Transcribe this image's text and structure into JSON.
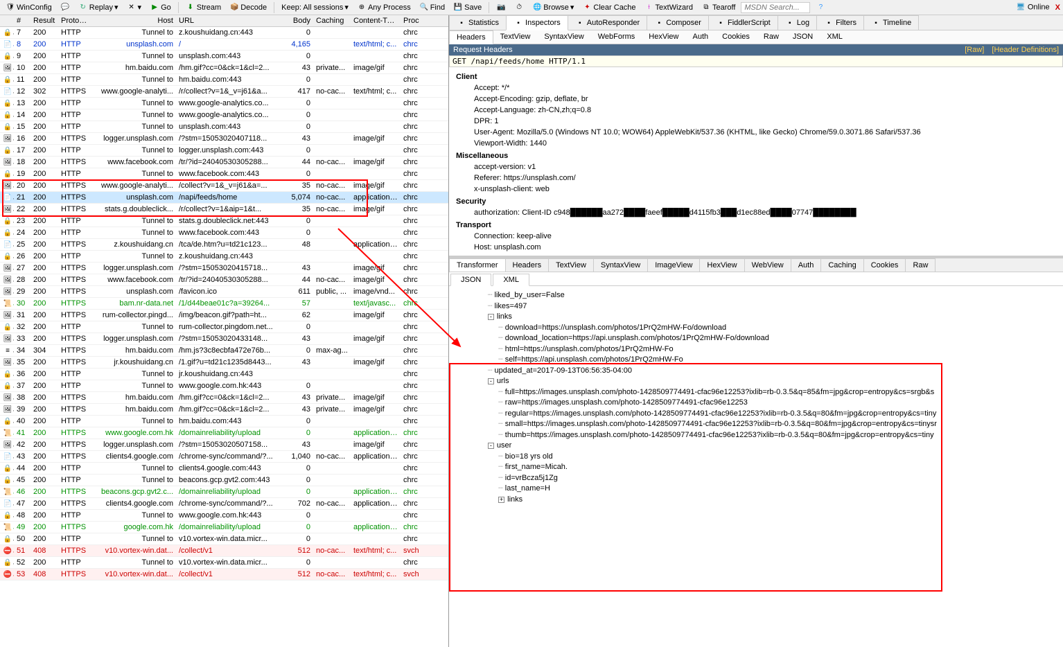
{
  "toolbar": {
    "winconfig": "WinConfig",
    "replay": "Replay",
    "go": "Go",
    "stream": "Stream",
    "decode": "Decode",
    "keep": "Keep: All sessions",
    "anyprocess": "Any Process",
    "find": "Find",
    "save": "Save",
    "browse": "Browse",
    "clearcache": "Clear Cache",
    "textwizard": "TextWizard",
    "tearoff": "Tearoff",
    "search_ph": "MSDN Search...",
    "online": "Online",
    "close": "X"
  },
  "columns": {
    "num": "#",
    "result": "Result",
    "protocol": "Protocol",
    "host": "Host",
    "url": "URL",
    "body": "Body",
    "caching": "Caching",
    "ctype": "Content-Type",
    "proc": "Proc"
  },
  "rows": [
    {
      "n": "7",
      "r": "200",
      "p": "HTTP",
      "h": "Tunnel to",
      "u": "z.koushuidang.cn:443",
      "b": "0",
      "c": "",
      "t": "",
      "pr": "chrc"
    },
    {
      "n": "8",
      "r": "200",
      "p": "HTTP",
      "h": "unsplash.com",
      "u": "/",
      "b": "4,165",
      "c": "",
      "t": "text/html; c...",
      "pr": "chrc",
      "cls": "blue"
    },
    {
      "n": "9",
      "r": "200",
      "p": "HTTP",
      "h": "Tunnel to",
      "u": "unsplash.com:443",
      "b": "0",
      "c": "",
      "t": "",
      "pr": "chrc"
    },
    {
      "n": "10",
      "r": "200",
      "p": "HTTP",
      "h": "hm.baidu.com",
      "u": "/hm.gif?cc=0&ck=1&cl=2...",
      "b": "43",
      "c": "private...",
      "t": "image/gif",
      "pr": "chrc"
    },
    {
      "n": "11",
      "r": "200",
      "p": "HTTP",
      "h": "Tunnel to",
      "u": "hm.baidu.com:443",
      "b": "0",
      "c": "",
      "t": "",
      "pr": "chrc"
    },
    {
      "n": "12",
      "r": "302",
      "p": "HTTPS",
      "h": "www.google-analyti...",
      "u": "/r/collect?v=1&_v=j61&a...",
      "b": "417",
      "c": "no-cac...",
      "t": "text/html; c...",
      "pr": "chrc"
    },
    {
      "n": "13",
      "r": "200",
      "p": "HTTP",
      "h": "Tunnel to",
      "u": "www.google-analytics.co...",
      "b": "0",
      "c": "",
      "t": "",
      "pr": "chrc"
    },
    {
      "n": "14",
      "r": "200",
      "p": "HTTP",
      "h": "Tunnel to",
      "u": "www.google-analytics.co...",
      "b": "0",
      "c": "",
      "t": "",
      "pr": "chrc"
    },
    {
      "n": "15",
      "r": "200",
      "p": "HTTP",
      "h": "Tunnel to",
      "u": "unsplash.com:443",
      "b": "0",
      "c": "",
      "t": "",
      "pr": "chrc"
    },
    {
      "n": "16",
      "r": "200",
      "p": "HTTPS",
      "h": "logger.unsplash.com",
      "u": "/?stm=15053020407118...",
      "b": "43",
      "c": "",
      "t": "image/gif",
      "pr": "chrc"
    },
    {
      "n": "17",
      "r": "200",
      "p": "HTTP",
      "h": "Tunnel to",
      "u": "logger.unsplash.com:443",
      "b": "0",
      "c": "",
      "t": "",
      "pr": "chrc"
    },
    {
      "n": "18",
      "r": "200",
      "p": "HTTPS",
      "h": "www.facebook.com",
      "u": "/tr/?id=24040530305288...",
      "b": "44",
      "c": "no-cac...",
      "t": "image/gif",
      "pr": "chrc"
    },
    {
      "n": "19",
      "r": "200",
      "p": "HTTP",
      "h": "Tunnel to",
      "u": "www.facebook.com:443",
      "b": "0",
      "c": "",
      "t": "",
      "pr": "chrc"
    },
    {
      "n": "20",
      "r": "200",
      "p": "HTTPS",
      "h": "www.google-analyti...",
      "u": "/collect?v=1&_v=j61&a=...",
      "b": "35",
      "c": "no-cac...",
      "t": "image/gif",
      "pr": "chrc"
    },
    {
      "n": "21",
      "r": "200",
      "p": "HTTPS",
      "h": "unsplash.com",
      "u": "/napi/feeds/home",
      "b": "5,074",
      "c": "no-cac...",
      "t": "application/...",
      "pr": "chrc",
      "cls": "sel"
    },
    {
      "n": "22",
      "r": "200",
      "p": "HTTPS",
      "h": "stats.g.doubleclick...",
      "u": "/r/collect?v=1&aip=1&t...",
      "b": "35",
      "c": "no-cac...",
      "t": "image/gif",
      "pr": "chrc"
    },
    {
      "n": "23",
      "r": "200",
      "p": "HTTP",
      "h": "Tunnel to",
      "u": "stats.g.doubleclick.net:443",
      "b": "0",
      "c": "",
      "t": "",
      "pr": "chrc"
    },
    {
      "n": "24",
      "r": "200",
      "p": "HTTP",
      "h": "Tunnel to",
      "u": "www.facebook.com:443",
      "b": "0",
      "c": "",
      "t": "",
      "pr": "chrc"
    },
    {
      "n": "25",
      "r": "200",
      "p": "HTTPS",
      "h": "z.koushuidang.cn",
      "u": "/tca/de.htm?u=td21c123...",
      "b": "48",
      "c": "",
      "t": "application/...",
      "pr": "chrc"
    },
    {
      "n": "26",
      "r": "200",
      "p": "HTTP",
      "h": "Tunnel to",
      "u": "z.koushuidang.cn:443",
      "b": "",
      "c": "",
      "t": "",
      "pr": "chrc"
    },
    {
      "n": "27",
      "r": "200",
      "p": "HTTPS",
      "h": "logger.unsplash.com",
      "u": "/?stm=15053020415718...",
      "b": "43",
      "c": "",
      "t": "image/gif",
      "pr": "chrc"
    },
    {
      "n": "28",
      "r": "200",
      "p": "HTTPS",
      "h": "www.facebook.com",
      "u": "/tr/?id=24040530305288...",
      "b": "44",
      "c": "no-cac...",
      "t": "image/gif",
      "pr": "chrc"
    },
    {
      "n": "29",
      "r": "200",
      "p": "HTTPS",
      "h": "unsplash.com",
      "u": "/favicon.ico",
      "b": "611",
      "c": "public, ...",
      "t": "image/vnd...",
      "pr": "chrc"
    },
    {
      "n": "30",
      "r": "200",
      "p": "HTTPS",
      "h": "bam.nr-data.net",
      "u": "/1/d44beae01c?a=39264...",
      "b": "57",
      "c": "",
      "t": "text/javasc...",
      "pr": "chrc",
      "cls": "green"
    },
    {
      "n": "31",
      "r": "200",
      "p": "HTTPS",
      "h": "rum-collector.pingd...",
      "u": "/img/beacon.gif?path=ht...",
      "b": "62",
      "c": "",
      "t": "image/gif",
      "pr": "chrc"
    },
    {
      "n": "32",
      "r": "200",
      "p": "HTTP",
      "h": "Tunnel to",
      "u": "rum-collector.pingdom.net...",
      "b": "0",
      "c": "",
      "t": "",
      "pr": "chrc"
    },
    {
      "n": "33",
      "r": "200",
      "p": "HTTPS",
      "h": "logger.unsplash.com",
      "u": "/?stm=15053020433148...",
      "b": "43",
      "c": "",
      "t": "image/gif",
      "pr": "chrc"
    },
    {
      "n": "34",
      "r": "304",
      "p": "HTTPS",
      "h": "hm.baidu.com",
      "u": "/hm.js?3c8ecbfa472e76b...",
      "b": "0",
      "c": "max-ag...",
      "t": "",
      "pr": "chrc"
    },
    {
      "n": "35",
      "r": "200",
      "p": "HTTPS",
      "h": "jr.koushuidang.cn",
      "u": "/1.gif?u=td21c1235d8443...",
      "b": "43",
      "c": "",
      "t": "image/gif",
      "pr": "chrc"
    },
    {
      "n": "36",
      "r": "200",
      "p": "HTTP",
      "h": "Tunnel to",
      "u": "jr.koushuidang.cn:443",
      "b": "",
      "c": "",
      "t": "",
      "pr": "chrc"
    },
    {
      "n": "37",
      "r": "200",
      "p": "HTTP",
      "h": "Tunnel to",
      "u": "www.google.com.hk:443",
      "b": "0",
      "c": "",
      "t": "",
      "pr": "chrc"
    },
    {
      "n": "38",
      "r": "200",
      "p": "HTTPS",
      "h": "hm.baidu.com",
      "u": "/hm.gif?cc=0&ck=1&cl=2...",
      "b": "43",
      "c": "private...",
      "t": "image/gif",
      "pr": "chrc"
    },
    {
      "n": "39",
      "r": "200",
      "p": "HTTPS",
      "h": "hm.baidu.com",
      "u": "/hm.gif?cc=0&ck=1&cl=2...",
      "b": "43",
      "c": "private...",
      "t": "image/gif",
      "pr": "chrc"
    },
    {
      "n": "40",
      "r": "200",
      "p": "HTTP",
      "h": "Tunnel to",
      "u": "hm.baidu.com:443",
      "b": "0",
      "c": "",
      "t": "",
      "pr": "chrc"
    },
    {
      "n": "41",
      "r": "200",
      "p": "HTTPS",
      "h": "www.google.com.hk",
      "u": "/domainreliability/upload",
      "b": "0",
      "c": "",
      "t": "application/...",
      "pr": "chrc",
      "cls": "green"
    },
    {
      "n": "42",
      "r": "200",
      "p": "HTTPS",
      "h": "logger.unsplash.com",
      "u": "/?stm=15053020507158...",
      "b": "43",
      "c": "",
      "t": "image/gif",
      "pr": "chrc"
    },
    {
      "n": "43",
      "r": "200",
      "p": "HTTPS",
      "h": "clients4.google.com",
      "u": "/chrome-sync/command/?...",
      "b": "1,040",
      "c": "no-cac...",
      "t": "application/...",
      "pr": "chrc"
    },
    {
      "n": "44",
      "r": "200",
      "p": "HTTP",
      "h": "Tunnel to",
      "u": "clients4.google.com:443",
      "b": "0",
      "c": "",
      "t": "",
      "pr": "chrc"
    },
    {
      "n": "45",
      "r": "200",
      "p": "HTTP",
      "h": "Tunnel to",
      "u": "beacons.gcp.gvt2.com:443",
      "b": "0",
      "c": "",
      "t": "",
      "pr": "chrc"
    },
    {
      "n": "46",
      "r": "200",
      "p": "HTTPS",
      "h": "beacons.gcp.gvt2.c...",
      "u": "/domainreliability/upload",
      "b": "0",
      "c": "",
      "t": "application/...",
      "pr": "chrc",
      "cls": "green"
    },
    {
      "n": "47",
      "r": "200",
      "p": "HTTPS",
      "h": "clients4.google.com",
      "u": "/chrome-sync/command/?...",
      "b": "702",
      "c": "no-cac...",
      "t": "application/...",
      "pr": "chrc"
    },
    {
      "n": "48",
      "r": "200",
      "p": "HTTP",
      "h": "Tunnel to",
      "u": "www.google.com.hk:443",
      "b": "0",
      "c": "",
      "t": "",
      "pr": "chrc"
    },
    {
      "n": "49",
      "r": "200",
      "p": "HTTPS",
      "h": "google.com.hk",
      "u": "/domainreliability/upload",
      "b": "0",
      "c": "",
      "t": "application/...",
      "pr": "chrc",
      "cls": "green"
    },
    {
      "n": "50",
      "r": "200",
      "p": "HTTP",
      "h": "Tunnel to",
      "u": "v10.vortex-win.data.micr...",
      "b": "0",
      "c": "",
      "t": "",
      "pr": "chrc"
    },
    {
      "n": "51",
      "r": "408",
      "p": "HTTPS",
      "h": "v10.vortex-win.dat...",
      "u": "/collect/v1",
      "b": "512",
      "c": "no-cac...",
      "t": "text/html; c...",
      "pr": "svch",
      "cls": "red redbg"
    },
    {
      "n": "52",
      "r": "200",
      "p": "HTTP",
      "h": "Tunnel to",
      "u": "v10.vortex-win.data.micr...",
      "b": "0",
      "c": "",
      "t": "",
      "pr": "chrc"
    },
    {
      "n": "53",
      "r": "408",
      "p": "HTTPS",
      "h": "v10.vortex-win.dat...",
      "u": "/collect/v1",
      "b": "512",
      "c": "no-cac...",
      "t": "text/html; c...",
      "pr": "svch",
      "cls": "red redbg"
    }
  ],
  "topTabs": [
    "Statistics",
    "Inspectors",
    "AutoResponder",
    "Composer",
    "FiddlerScript",
    "Log",
    "Filters",
    "Timeline"
  ],
  "reqTabs": [
    "Headers",
    "TextView",
    "SyntaxView",
    "WebForms",
    "HexView",
    "Auth",
    "Cookies",
    "Raw",
    "JSON",
    "XML"
  ],
  "reqTitle": "Request Headers",
  "rawLinks": {
    "raw": "[Raw]",
    "defs": "[Header Definitions]"
  },
  "rawReq": "GET /napi/feeds/home HTTP/1.1",
  "headers": {
    "Client": [
      "Accept: */*",
      "Accept-Encoding: gzip, deflate, br",
      "Accept-Language: zh-CN,zh;q=0.8",
      "DPR: 1",
      "User-Agent: Mozilla/5.0 (Windows NT 10.0; WOW64) AppleWebKit/537.36 (KHTML, like Gecko) Chrome/59.0.3071.86 Safari/537.36",
      "Viewport-Width: 1440"
    ],
    "Miscellaneous": [
      "accept-version: v1",
      "Referer: https://unsplash.com/",
      "x-unsplash-client: web"
    ],
    "Security": [
      "authorization: Client-ID c948██████aa272████faeef█████d4115fb3███d1ec88ed████07747████████"
    ],
    "Transport": [
      "Connection: keep-alive",
      "Host: unsplash.com"
    ]
  },
  "respTabs": [
    "Transformer",
    "Headers",
    "TextView",
    "SyntaxView",
    "ImageView",
    "HexView",
    "WebView",
    "Auth",
    "Caching",
    "Cookies",
    "Raw"
  ],
  "respSubTabs": [
    "JSON",
    "XML"
  ],
  "json": [
    {
      "ind": 3,
      "t": "liked_by_user=False"
    },
    {
      "ind": 3,
      "t": "likes=497"
    },
    {
      "ind": 3,
      "t": "links",
      "exp": "-"
    },
    {
      "ind": 4,
      "t": "download=https://unsplash.com/photos/1PrQ2mHW-Fo/download"
    },
    {
      "ind": 4,
      "t": "download_location=https://api.unsplash.com/photos/1PrQ2mHW-Fo/download"
    },
    {
      "ind": 4,
      "t": "html=https://unsplash.com/photos/1PrQ2mHW-Fo"
    },
    {
      "ind": 4,
      "t": "self=https://api.unsplash.com/photos/1PrQ2mHW-Fo"
    },
    {
      "ind": 3,
      "t": "updated_at=2017-09-13T06:56:35-04:00"
    },
    {
      "ind": 3,
      "t": "urls",
      "exp": "-"
    },
    {
      "ind": 4,
      "t": "full=https://images.unsplash.com/photo-1428509774491-cfac96e12253?ixlib=rb-0.3.5&q=85&fm=jpg&crop=entropy&cs=srgb&s"
    },
    {
      "ind": 4,
      "t": "raw=https://images.unsplash.com/photo-1428509774491-cfac96e12253"
    },
    {
      "ind": 4,
      "t": "regular=https://images.unsplash.com/photo-1428509774491-cfac96e12253?ixlib=rb-0.3.5&q=80&fm=jpg&crop=entropy&cs=tiny"
    },
    {
      "ind": 4,
      "t": "small=https://images.unsplash.com/photo-1428509774491-cfac96e12253?ixlib=rb-0.3.5&q=80&fm=jpg&crop=entropy&cs=tinysr"
    },
    {
      "ind": 4,
      "t": "thumb=https://images.unsplash.com/photo-1428509774491-cfac96e12253?ixlib=rb-0.3.5&q=80&fm=jpg&crop=entropy&cs=tiny"
    },
    {
      "ind": 3,
      "t": "user",
      "exp": "-"
    },
    {
      "ind": 4,
      "t": "bio=18 yrs old"
    },
    {
      "ind": 4,
      "t": "first_name=Micah."
    },
    {
      "ind": 4,
      "t": "id=vrBcza5j1Zg"
    },
    {
      "ind": 4,
      "t": "last_name=H"
    },
    {
      "ind": 4,
      "t": "links",
      "exp": "+"
    }
  ]
}
